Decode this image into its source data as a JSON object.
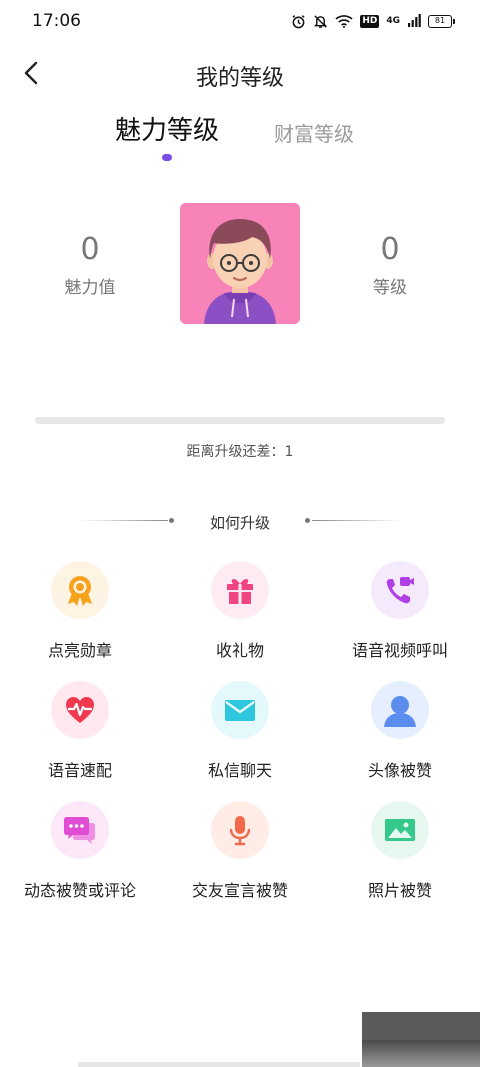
{
  "status_bar": {
    "time": "17:06",
    "network_label": "4G",
    "hd_label": "HD",
    "battery_level": "81"
  },
  "header": {
    "title": "我的等级"
  },
  "tabs": {
    "charm": "魅力等级",
    "wealth": "财富等级",
    "active": "charm"
  },
  "profile": {
    "charm_value": "0",
    "charm_value_label": "魅力值",
    "level_value": "0",
    "level_label": "等级",
    "progress_fraction": 0
  },
  "upgrade_gap_text": "距离升级还差：1",
  "how_to_upgrade": {
    "title": "如何升级",
    "items": [
      {
        "label": "点亮勋章",
        "icon": "medal-icon",
        "bg": "#fff4e3",
        "color": "#f7a21b"
      },
      {
        "label": "收礼物",
        "icon": "gift-icon",
        "bg": "#ffebf3",
        "color": "#f0467f"
      },
      {
        "label": "语音视频呼叫",
        "icon": "video-call-icon",
        "bg": "#f4eafc",
        "color": "#b040e6"
      },
      {
        "label": "语音速配",
        "icon": "heart-pulse-icon",
        "bg": "#ffe9ee",
        "color": "#f0394f"
      },
      {
        "label": "私信聊天",
        "icon": "mail-icon",
        "bg": "#e4f9fc",
        "color": "#2fc7de"
      },
      {
        "label": "头像被赞",
        "icon": "user-avatar-icon",
        "bg": "#e6efff",
        "color": "#5b8def"
      },
      {
        "label": "动态被赞或评论",
        "icon": "chat-bubbles-icon",
        "bg": "#fce8f8",
        "color": "#e04dd3"
      },
      {
        "label": "交友宣言被赞",
        "icon": "microphone-icon",
        "bg": "#ffece7",
        "color": "#f2694a"
      },
      {
        "label": "照片被赞",
        "icon": "photo-icon",
        "bg": "#e6f8ef",
        "color": "#34c98a"
      }
    ]
  }
}
